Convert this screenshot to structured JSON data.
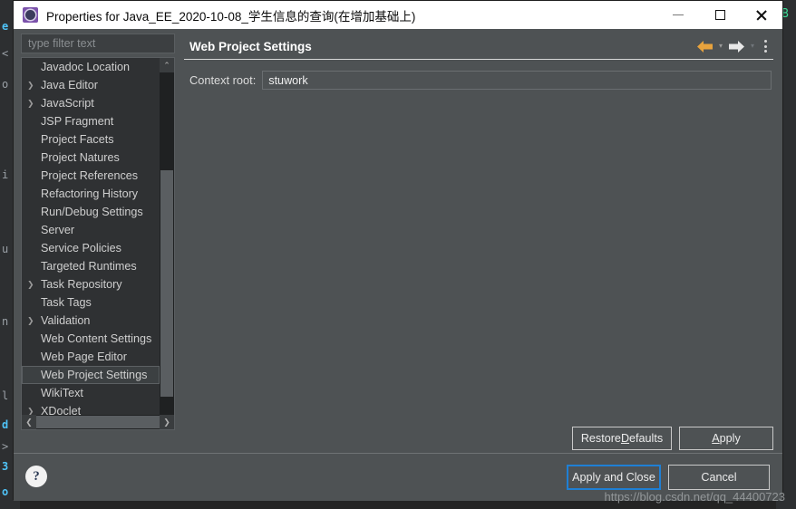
{
  "window": {
    "title": "Properties for Java_EE_2020-10-08_学生信息的查询(在增加基础上)",
    "icon": "properties-gear-icon",
    "minimize_label": "—",
    "maximize_label": "□",
    "close_label": "✕"
  },
  "filter": {
    "placeholder": "type filter text",
    "value": ""
  },
  "tree": {
    "items": [
      {
        "label": "Javadoc Location",
        "expandable": false,
        "selected": false
      },
      {
        "label": "Java Editor",
        "expandable": true,
        "selected": false
      },
      {
        "label": "JavaScript",
        "expandable": true,
        "selected": false
      },
      {
        "label": "JSP Fragment",
        "expandable": false,
        "selected": false
      },
      {
        "label": "Project Facets",
        "expandable": false,
        "selected": false
      },
      {
        "label": "Project Natures",
        "expandable": false,
        "selected": false
      },
      {
        "label": "Project References",
        "expandable": false,
        "selected": false
      },
      {
        "label": "Refactoring History",
        "expandable": false,
        "selected": false
      },
      {
        "label": "Run/Debug Settings",
        "expandable": false,
        "selected": false
      },
      {
        "label": "Server",
        "expandable": false,
        "selected": false
      },
      {
        "label": "Service Policies",
        "expandable": false,
        "selected": false
      },
      {
        "label": "Targeted Runtimes",
        "expandable": false,
        "selected": false
      },
      {
        "label": "Task Repository",
        "expandable": true,
        "selected": false
      },
      {
        "label": "Task Tags",
        "expandable": false,
        "selected": false
      },
      {
        "label": "Validation",
        "expandable": true,
        "selected": false
      },
      {
        "label": "Web Content Settings",
        "expandable": false,
        "selected": false
      },
      {
        "label": "Web Page Editor",
        "expandable": false,
        "selected": false
      },
      {
        "label": "Web Project Settings",
        "expandable": false,
        "selected": true
      },
      {
        "label": "WikiText",
        "expandable": false,
        "selected": false
      },
      {
        "label": "XDoclet",
        "expandable": true,
        "selected": false
      }
    ],
    "expand_glyph": "❯",
    "scroll_up_glyph": "⌃",
    "scroll_down_glyph": "⌄",
    "scroll_left_glyph": "❮",
    "scroll_right_glyph": "❯"
  },
  "panel": {
    "title": "Web Project Settings",
    "nav": {
      "back_icon": "back-arrow-icon",
      "back_color": "#e8a33d",
      "forward_icon": "forward-arrow-icon",
      "forward_color": "#e8e8e8",
      "dropdown_glyph": "▾",
      "menu_icon": "kebab-menu-icon"
    },
    "context_root": {
      "label": "Context root:",
      "value": "stuwork",
      "placeholder": ""
    },
    "restore_defaults": {
      "pre": "Restore ",
      "mnemonic": "D",
      "post": "efaults"
    },
    "apply": {
      "pre": "",
      "mnemonic": "A",
      "post": "pply"
    }
  },
  "footer": {
    "help_glyph": "?",
    "apply_and_close": "Apply and Close",
    "cancel": "Cancel",
    "focus_color": "#1f7fd4"
  },
  "watermark": "https://blog.csdn.net/qq_44400723",
  "background_bleed": {
    "left_chars": [
      "e",
      "<",
      "o",
      "i",
      "u",
      "n",
      "l",
      "d",
      ">",
      "3",
      "o"
    ],
    "right_char": "B",
    "right_char_color": "#3ddc97"
  }
}
